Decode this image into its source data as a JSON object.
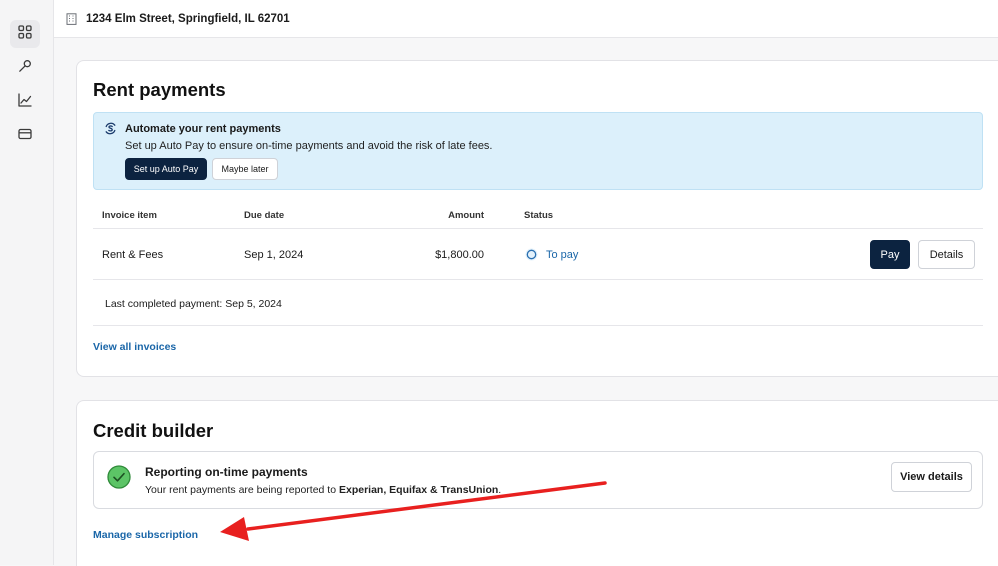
{
  "sidebar": {
    "items": [
      {
        "icon": "grid-icon",
        "active": true
      },
      {
        "icon": "wrench-icon",
        "active": false
      },
      {
        "icon": "chart-line-icon",
        "active": false
      },
      {
        "icon": "credit-card-icon",
        "active": false
      }
    ]
  },
  "header": {
    "property_icon": "building-icon",
    "address": "1234 Elm Street, Springfield, IL 62701"
  },
  "rent_payments": {
    "title": "Rent payments",
    "autopay_banner": {
      "icon": "autopay-icon",
      "title": "Automate your rent payments",
      "text": "Set up Auto Pay to ensure on-time payments and avoid the risk of late fees.",
      "primary_button": "Set up Auto Pay",
      "secondary_button": "Maybe later"
    },
    "table": {
      "columns": [
        "Invoice item",
        "Due date",
        "Amount",
        "Status"
      ],
      "rows": [
        {
          "item": "Rent & Fees",
          "due_date": "Sep 1, 2024",
          "amount": "$1,800.00",
          "status": "To pay",
          "pay_button": "Pay",
          "details_button": "Details"
        }
      ]
    },
    "last_payment": "Last completed payment: Sep 5, 2024",
    "view_all_link": "View all invoices"
  },
  "credit_builder": {
    "title": "Credit builder",
    "report": {
      "icon": "check-circle-icon",
      "title": "Reporting on-time payments",
      "text_prefix": "Your rent payments are being reported to ",
      "bureaus": "Experian, Equifax & TransUnion",
      "text_suffix": ".",
      "button": "View details"
    },
    "manage_link": "Manage subscription"
  },
  "colors": {
    "primary_dark": "#0c2340",
    "link_blue": "#1a66a8",
    "banner_bg": "#dcf0fb",
    "success_green": "#3cb54a",
    "annotation_arrow": "#e8201f"
  }
}
